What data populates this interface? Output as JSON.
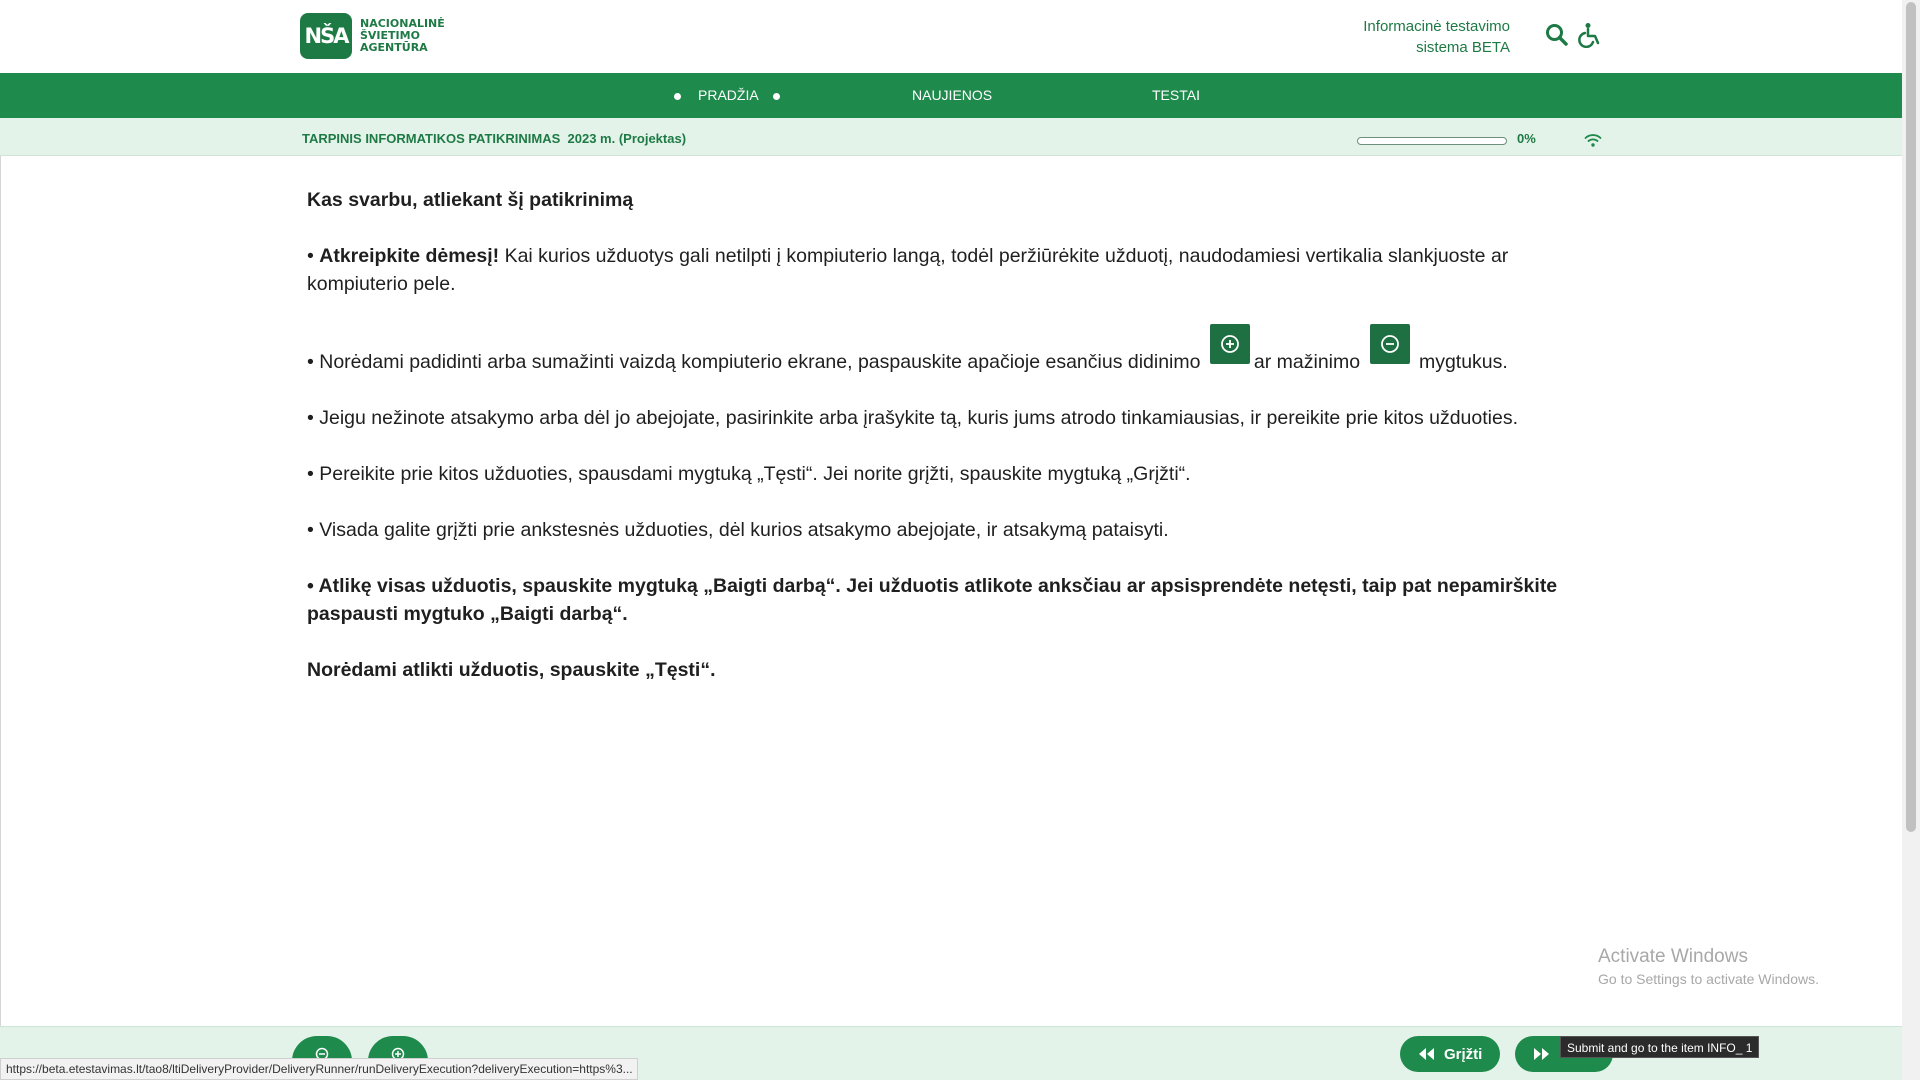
{
  "header": {
    "logo_mark": "NŠA",
    "logo_lines": [
      "NACIONALINĖ",
      "ŠVIETIMO",
      "AGENTŪRA"
    ],
    "system_title_line1": "Informacinė testavimo",
    "system_title_line2": "sistema BETA",
    "icons": [
      "search-icon",
      "accessibility-icon"
    ]
  },
  "nav": {
    "items": [
      {
        "label": "PRADŽIA",
        "active": true
      },
      {
        "label": "NAUJIENOS",
        "active": false
      },
      {
        "label": "TESTAI",
        "active": false
      }
    ]
  },
  "test": {
    "title": "TARPINIS INFORMATIKOS PATIKRINIMAS  2023 m. (Projektas)",
    "progress_value": 0,
    "progress_label": "0%"
  },
  "content": {
    "heading": "Kas svarbu, atliekant šį patikrinimą",
    "p1_bold": "Atkreipkite dėmesį!",
    "p1_text": " Kai kurios užduotys gali netilpti į kompiuterio langą, todėl peržiūrėkite užduotį, naudodamiesi vertikalia slankjuoste ar kompiuterio pele.",
    "p2_before": "Norėdami padidinti arba sumažinti vaizdą kompiuterio ekrane, paspauskite apačioje esančius didinimo",
    "p2_middle": "ar mažinimo",
    "p2_after": "mygtukus.",
    "p3": "Jeigu nežinote atsakymo arba dėl jo abejojate, pasirinkite arba įrašykite tą, kuris jums atrodo tinkamiausias, ir pereikite prie kitos užduoties.",
    "p4": "Pereikite prie kitos užduoties, spausdami mygtuką „Tęsti“. Jei norite grįžti, spauskite mygtuką „Grįžti“.",
    "p5": "Visada galite grįžti prie ankstesnės užduoties, dėl kurios atsakymo abejojate, ir atsakymą pataisyti.",
    "p6": "Atlikę visas užduotis, spauskite mygtuką „Baigti darbą“. Jei užduotis atlikote anksčiau ar apsisprendėte netęsti, taip pat nepamirškite paspausti mygtuko „Baigti darbą“.",
    "p7": "Norėdami atlikti užduotis, spauskite „Tęsti“."
  },
  "footer": {
    "back_label": "Grįžti",
    "tooltip": "Submit and go to the item INFO_ 1",
    "status_url": "https://beta.etestavimas.lt/tao8/ltiDeliveryProvider/DeliveryRunner/runDeliveryExecution?deliveryExecution=https%3..."
  },
  "watermark": {
    "line1": "Activate Windows",
    "line2": "Go to Settings to activate Windows."
  },
  "colors": {
    "brand_green": "#1e8a4c",
    "light_green_bar": "#e4f3ea"
  }
}
